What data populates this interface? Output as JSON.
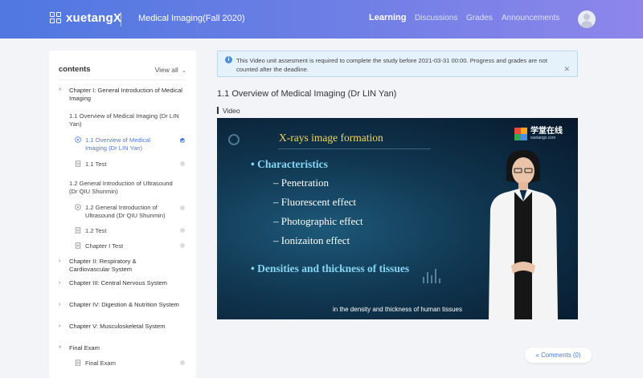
{
  "header": {
    "logo_text": "xuetangX",
    "course_title": "Medical Imaging(Fall 2020)",
    "nav": [
      "Learning",
      "Discussions",
      "Grades",
      "Announcements"
    ],
    "active_nav": "Learning"
  },
  "sidebar": {
    "title": "contents",
    "view_all": "View all",
    "chapter1": "Chapter I: General Introduction of Medical Imaging",
    "s11": "1.1 Overview of Medical Imaging (Dr LIN Yan)",
    "s11_video": "1.1 Overview of Medical Imaging (Dr LIN Yan)",
    "s11_test": "1.1 Test",
    "s12": "1.2 General Introduction of Ultrasound (Dr QIU Shunmin)",
    "s12_video": "1.2 General Introduction of Ultrasound (Dr QIU Shunmin)",
    "s12_test": "1.2 Test",
    "ch1_test": "Chapter I Test",
    "chapter2": "Chapter II: Respiratory & Cardiovascular System",
    "chapter3": "Chapter III: Central Nervous System",
    "chapter4": "Chapter IV: Digestion & Nutrition System",
    "chapter5": "Chapter V: Musculoskeletal System",
    "final": "Final Exam",
    "final_item": "Final Exam"
  },
  "notice": {
    "text": "This Video unit assesment is required to complete the study before 2021-03-31 00:00. Progress and grades are not counted after the deadline."
  },
  "main": {
    "section_title": "1.1 Overview of Medical Imaging (Dr LIN Yan)",
    "video_label": "Video",
    "comments": "Comments (0)"
  },
  "video": {
    "heading": "X-rays image formation",
    "bullet1": "Characteristics",
    "subs": [
      "Penetration",
      "Fluorescent effect",
      "Photographic effect",
      "Ionizaiton effect"
    ],
    "bullet2": "Densities and thickness of tissues",
    "caption": "in the density and thickness of human tissues",
    "logo_cn": "学堂在线",
    "logo_url": "xuetangx.com"
  },
  "colors": {
    "accent": "#4a7be0",
    "video_heading": "#f2d45c",
    "video_bullet": "#86d6f4"
  }
}
